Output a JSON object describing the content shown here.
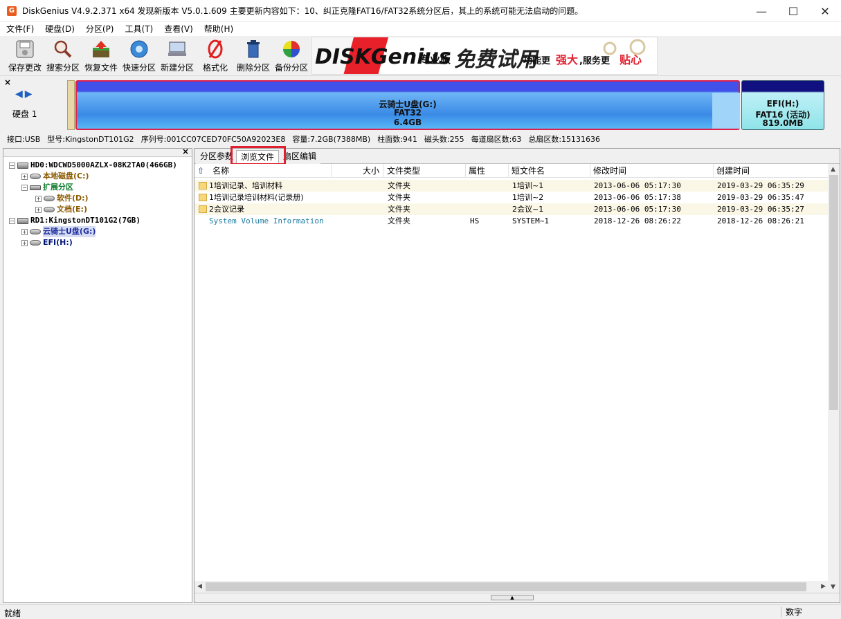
{
  "window": {
    "title": "DiskGenius V4.9.2.371 x64    发现新版本 V5.0.1.609 主要更新内容如下：10、纠正克隆FAT16/FAT32系统分区后，其上的系统可能无法启动的问题。",
    "min": "—",
    "max": "☐",
    "close": "✕"
  },
  "menu": [
    "文件(F)",
    "硬盘(D)",
    "分区(P)",
    "工具(T)",
    "查看(V)",
    "帮助(H)"
  ],
  "toolbar": {
    "buttons": [
      {
        "label": "保存更改",
        "icon": "save-icon"
      },
      {
        "label": "搜索分区",
        "icon": "magnifier-icon"
      },
      {
        "label": "恢复文件",
        "icon": "recover-icon"
      },
      {
        "label": "快速分区",
        "icon": "quick-partition-icon"
      },
      {
        "label": "新建分区",
        "icon": "new-partition-icon"
      },
      {
        "label": "格式化",
        "icon": "format-icon"
      },
      {
        "label": "删除分区",
        "icon": "delete-icon"
      },
      {
        "label": "备份分区",
        "icon": "backup-icon"
      }
    ],
    "banner": {
      "brand": "DISKGenius",
      "edition": "专业版",
      "free": "免费试用",
      "slogan1": "功能更",
      "slogan1b": "强大",
      "slogan2": ",服务更",
      "slogan2b": "贴心"
    }
  },
  "diskmap": {
    "disk_label": "硬盘 1",
    "partition_g": {
      "name": "云骑士U盘(G:)",
      "fs": "FAT32",
      "size": "6.4GB"
    },
    "partition_h": {
      "name": "EFI(H:)",
      "fs": "FAT16 (活动)",
      "size": "819.0MB"
    },
    "info": [
      "接口:USB",
      "型号:KingstonDT101G2",
      "序列号:001CC07CED70FC50A92023E8",
      "容量:7.2GB(7388MB)",
      "柱面数:941",
      "磁头数:255",
      "每道扇区数:63",
      "总扇区数:15131636"
    ]
  },
  "tree": [
    {
      "label": "HD0:WDCWD5000AZLX-08K2TA0(466GB)"
    },
    {
      "label": "本地磁盘(C:)"
    },
    {
      "label": "扩展分区"
    },
    {
      "label": "软件(D:)"
    },
    {
      "label": "文档(E:)"
    },
    {
      "label": "RD1:KingstonDT101G2(7GB)"
    },
    {
      "label": "云骑士U盘(G:)"
    },
    {
      "label": "EFI(H:)"
    }
  ],
  "tabs": [
    "分区参数",
    "浏览文件",
    "扇区编辑"
  ],
  "columns": [
    "名称",
    "大小",
    "文件类型",
    "属性",
    "短文件名",
    "修改时间",
    "创建时间"
  ],
  "files": [
    {
      "name": "1培训记录、培训材料",
      "size": "",
      "type": "文件夹",
      "attr": "",
      "short": "1培训~1",
      "modified": "2013-06-06 05:17:30",
      "created": "2019-03-29 06:35:29"
    },
    {
      "name": "1培训记录培训材料(记录册)",
      "size": "",
      "type": "文件夹",
      "attr": "",
      "short": "1培训~2",
      "modified": "2013-06-06 05:17:38",
      "created": "2019-03-29 06:35:47"
    },
    {
      "name": "2会议记录",
      "size": "",
      "type": "文件夹",
      "attr": "",
      "short": "2会议~1",
      "modified": "2013-06-06 05:17:30",
      "created": "2019-03-29 06:35:27"
    },
    {
      "name": "System Volume Information",
      "size": "",
      "type": "文件夹",
      "attr": "HS",
      "short": "SYSTEM~1",
      "modified": "2018-12-26 08:26:22",
      "created": "2018-12-26 08:26:21"
    }
  ],
  "status": {
    "text": "就绪",
    "numlock": "数字"
  },
  "colors": {
    "partition_border": "#e0204a",
    "partition_fill": "#3a8ae6",
    "efi_fill": "#8ee4e8",
    "tab_highlight": "#e02030"
  }
}
